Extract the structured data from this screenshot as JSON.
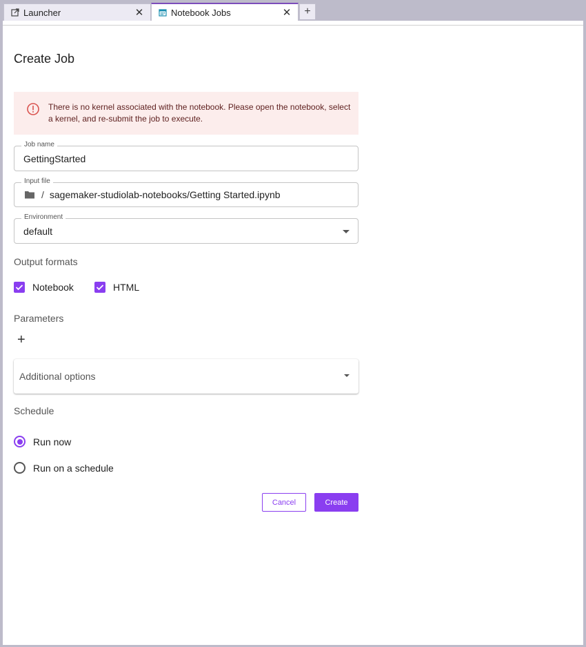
{
  "tabs": [
    {
      "label": "Launcher",
      "icon": "launcher-icon",
      "active": false
    },
    {
      "label": "Notebook Jobs",
      "icon": "calendar-icon",
      "active": true
    }
  ],
  "page": {
    "title": "Create Job"
  },
  "alert": {
    "message": "There is no kernel associated with the notebook. Please open the notebook, select a kernel, and re-submit the job to execute.",
    "icon": "error-circle-icon"
  },
  "form": {
    "job_name": {
      "label": "Job name",
      "value": "GettingStarted"
    },
    "input_file": {
      "label": "Input file",
      "separator": "/",
      "value": "sagemaker-studiolab-notebooks/Getting Started.ipynb"
    },
    "environment": {
      "label": "Environment",
      "value": "default"
    }
  },
  "output_formats": {
    "label": "Output formats",
    "options": [
      {
        "label": "Notebook",
        "checked": true
      },
      {
        "label": "HTML",
        "checked": true
      }
    ]
  },
  "parameters": {
    "label": "Parameters",
    "add_symbol": "+"
  },
  "additional_options": {
    "label": "Additional options"
  },
  "schedule": {
    "label": "Schedule",
    "options": [
      {
        "label": "Run now",
        "selected": true
      },
      {
        "label": "Run on a schedule",
        "selected": false
      }
    ]
  },
  "buttons": {
    "cancel": "Cancel",
    "create": "Create"
  },
  "colors": {
    "accent": "#8a3ef0",
    "alert_bg": "#fcedec",
    "alert_icon": "#d9534f"
  }
}
